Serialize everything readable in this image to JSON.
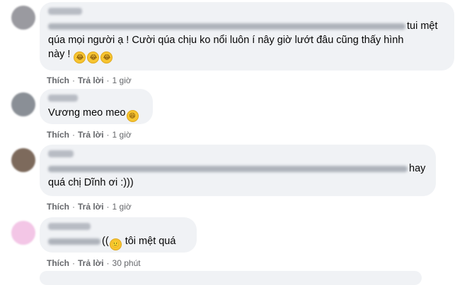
{
  "actions": {
    "like": "Thích",
    "reply": "Trả lời",
    "separator": "·"
  },
  "comments": [
    {
      "author": "",
      "line1_text": "tui mệt",
      "line2": "qúa mọi người ạ ! Cười qúa chịu ko nổi luôn í nây giờ lướt đâu cũng thấy hình",
      "line3": "này !",
      "emoji": [
        "rofl",
        "rofl",
        "rofl"
      ],
      "time": "1 giờ"
    },
    {
      "author": "",
      "text": "Vương meo meo",
      "emoji": [
        "laughing"
      ],
      "time": "1 giờ"
    },
    {
      "author": "",
      "line1_text": "hay",
      "line2": "quá chị Dĩnh ơi :)))",
      "time": "1 giờ"
    },
    {
      "author": "",
      "prefix": "((",
      "emoji": [
        "smile"
      ],
      "text": "tôi mệt quá",
      "time": "30 phút"
    }
  ]
}
